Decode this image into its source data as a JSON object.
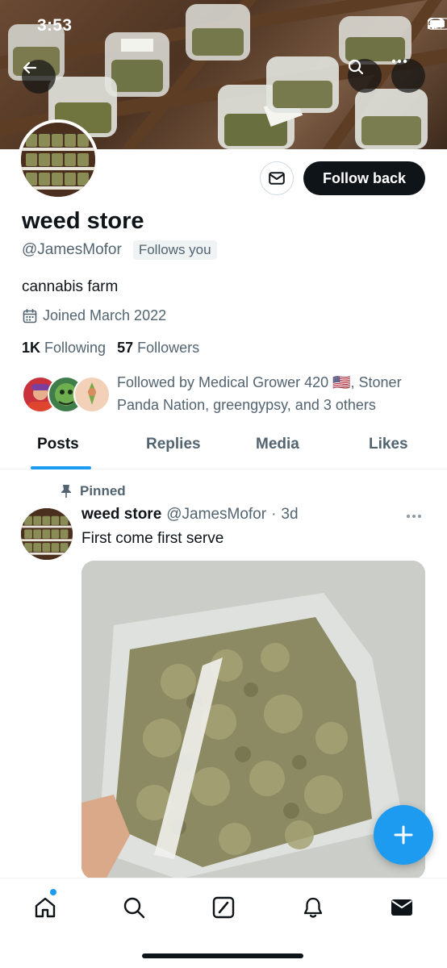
{
  "status_bar": {
    "time": "3:53"
  },
  "profile": {
    "display_name": "weed store",
    "handle": "@JamesMofor",
    "follows_you_badge": "Follows you",
    "bio": "cannabis farm",
    "joined": "Joined March 2022",
    "following_count": "1K",
    "following_label": "Following",
    "followers_count": "57",
    "followers_label": "Followers",
    "followed_by": "Followed by Medical Grower 420 🇺🇸, Stoner Panda Nation, greengypsy, and 3 others"
  },
  "header_buttons": {
    "follow_back_label": "Follow back",
    "back_icon": "arrow-left-icon",
    "search_icon": "search-icon",
    "more_icon": "more-horizontal-icon",
    "message_icon": "mail-icon"
  },
  "tabs": [
    {
      "label": "Posts",
      "active": true
    },
    {
      "label": "Replies",
      "active": false
    },
    {
      "label": "Media",
      "active": false
    },
    {
      "label": "Likes",
      "active": false
    }
  ],
  "post": {
    "pinned_label": "Pinned",
    "author_name": "weed store",
    "author_handle": "@JamesMofor",
    "separator": "·",
    "age": "3d",
    "text": "First come first serve"
  },
  "bottom_nav": [
    "home-icon",
    "search-icon",
    "compose-icon",
    "bell-icon",
    "mail-icon"
  ],
  "colors": {
    "accent": "#1d9bf0",
    "text_primary": "#0f1419",
    "text_secondary": "#536471",
    "follow_button_bg": "#0f1419"
  }
}
